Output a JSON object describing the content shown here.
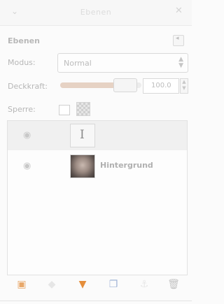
{
  "window": {
    "title": "Ebenen"
  },
  "panel": {
    "title": "Ebenen",
    "mode_label": "Modus:",
    "mode_value": "Normal",
    "opacity_label": "Deckkraft:",
    "opacity_value": "100.0",
    "opacity_fraction": 1.0,
    "lock_label": "Sperre:"
  },
  "layers": [
    {
      "name": "",
      "visible": true,
      "selected": true,
      "thumb": "text-layer-icon"
    },
    {
      "name": "Hintergrund",
      "visible": true,
      "selected": false,
      "thumb": "portrait-photo"
    }
  ],
  "toolbar": {
    "buttons": [
      {
        "icon": "new-layer-icon",
        "color": "#e8a86a"
      },
      {
        "icon": "raise-layer-icon",
        "color": "#e6e6e6"
      },
      {
        "icon": "lower-layer-icon",
        "color": "#e58e3c"
      },
      {
        "icon": "duplicate-layer-icon",
        "color": "#9fb3d6"
      },
      {
        "icon": "anchor-layer-icon",
        "color": "#e8e8e8"
      },
      {
        "icon": "delete-layer-icon",
        "color": "#c4c4c4"
      }
    ]
  }
}
